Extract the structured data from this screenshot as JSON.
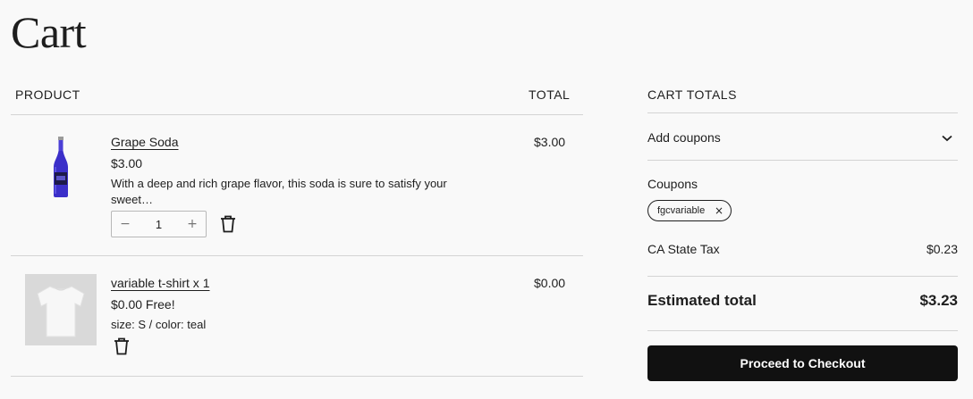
{
  "page": {
    "title": "Cart"
  },
  "table": {
    "col_product": "PRODUCT",
    "col_total": "TOTAL"
  },
  "items": [
    {
      "name": "Grape Soda",
      "price": "$3.00",
      "description": "With a deep and rich grape flavor, this soda is sure to satisfy your sweet…",
      "quantity": "1",
      "line_total": "$3.00",
      "qty_minus": "−",
      "qty_plus": "+"
    },
    {
      "name": "variable t-shirt x 1",
      "price": "$0.00 Free!",
      "attributes": "size: S / color: teal",
      "line_total": "$0.00"
    }
  ],
  "totals": {
    "heading": "CART TOTALS",
    "add_coupons": "Add coupons",
    "coupons_label": "Coupons",
    "coupon_code": "fgcvariable",
    "coupon_remove": "×",
    "tax_label": "CA State Tax",
    "tax_value": "$0.23",
    "estimated_label": "Estimated total",
    "estimated_value": "$3.23",
    "checkout_label": "Proceed to Checkout"
  },
  "colors": {
    "bottle": "#3b2fc9",
    "button": "#111111"
  },
  "icons": {
    "trash": "trash-icon",
    "chevron": "chevron-down-icon",
    "remove": "close-icon"
  }
}
